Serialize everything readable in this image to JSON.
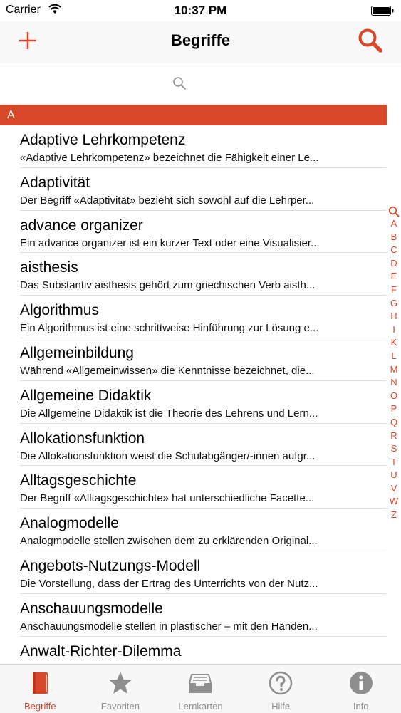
{
  "status_bar": {
    "carrier": "Carrier",
    "time": "10:37 PM"
  },
  "nav": {
    "title": "Begriffe",
    "add_icon": "plus-icon",
    "search_icon": "search-icon"
  },
  "search": {
    "placeholder": ""
  },
  "section": {
    "label": "A"
  },
  "items": [
    {
      "title": "Adaptive Lehrkompetenz",
      "desc": "«Adaptive Lehrkompetenz» bezeichnet die Fähigkeit einer Le..."
    },
    {
      "title": "Adaptivität",
      "desc": "Der Begriff «Adaptivität» bezieht sich sowohl auf die Lehrper..."
    },
    {
      "title": "advance organizer",
      "desc": "Ein advance organizer ist ein kurzer Text oder eine Visualisier..."
    },
    {
      "title": "aisthesis",
      "desc": "Das Substantiv aisthesis gehört zum griechischen Verb aisth..."
    },
    {
      "title": "Algorithmus",
      "desc": "Ein Algorithmus ist eine schrittweise Hinführung zur Lösung e..."
    },
    {
      "title": "Allgemeinbildung",
      "desc": "Während «Allgemeinwissen» die Kenntnisse bezeichnet, die..."
    },
    {
      "title": "Allgemeine Didaktik",
      "desc": "Die Allgemeine Didaktik ist die Theorie des Lehrens und Lern..."
    },
    {
      "title": "Allokationsfunktion",
      "desc": "Die Allokationsfunktion weist die Schulabgänger/-innen aufgr..."
    },
    {
      "title": "Alltagsgeschichte",
      "desc": "Der Begriff «Alltagsgeschichte» hat unterschiedliche Facette..."
    },
    {
      "title": "Analogmodelle",
      "desc": "Analogmodelle stellen zwischen dem zu erklärenden Original..."
    },
    {
      "title": "Angebots-Nutzungs-Modell",
      "desc": "Die Vorstellung, dass der Ertrag des Unterrichts von der Nutz..."
    },
    {
      "title": "Anschauungsmodelle",
      "desc": "Anschauungsmodelle stellen in plastischer – mit den Händen..."
    },
    {
      "title": "Anwalt-Richter-Dilemma",
      "desc": ""
    }
  ],
  "index_letters": [
    "A",
    "B",
    "C",
    "D",
    "E",
    "F",
    "G",
    "H",
    "I",
    "K",
    "L",
    "M",
    "N",
    "O",
    "P",
    "Q",
    "R",
    "S",
    "T",
    "U",
    "V",
    "W",
    "Z"
  ],
  "tabs": [
    {
      "label": "Begriffe",
      "icon": "book-icon",
      "active": true
    },
    {
      "label": "Favoriten",
      "icon": "star-icon",
      "active": false
    },
    {
      "label": "Lernkarten",
      "icon": "inbox-icon",
      "active": false
    },
    {
      "label": "Hilfe",
      "icon": "question-icon",
      "active": false
    },
    {
      "label": "Info",
      "icon": "info-icon",
      "active": false
    }
  ],
  "colors": {
    "accent": "#d9472b",
    "inactive": "#8e8e8e"
  }
}
